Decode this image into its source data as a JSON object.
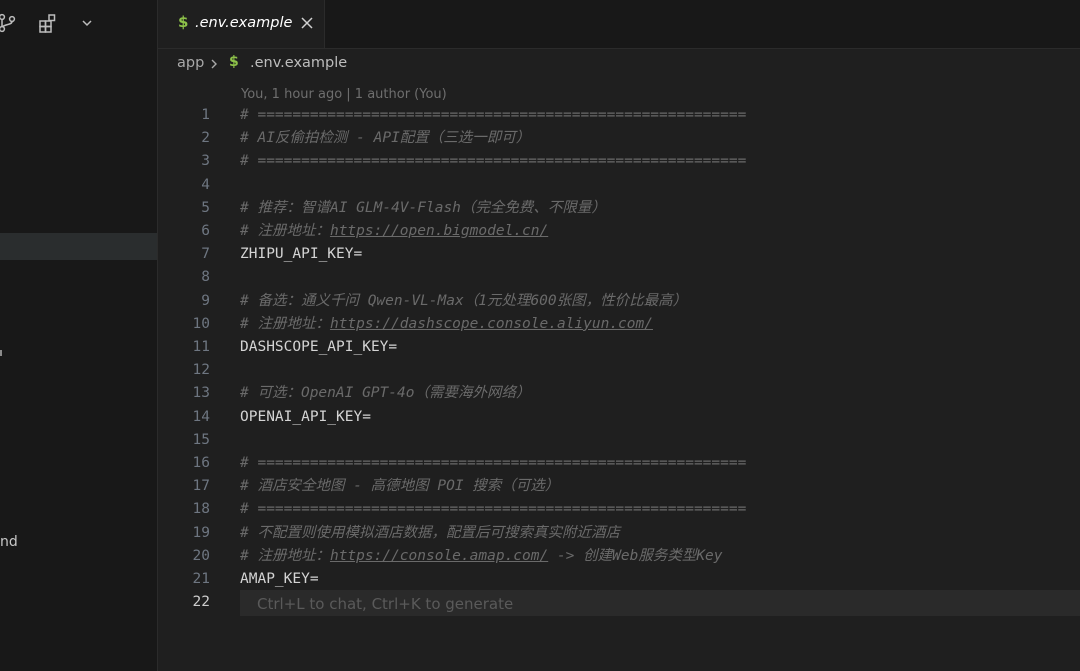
{
  "sidebar": {
    "fragment_text": "nd"
  },
  "tab": {
    "icon_glyph": "$",
    "label": ".env.example"
  },
  "breadcrumb": {
    "folder": "app",
    "icon_glyph": "$",
    "file": ".env.example"
  },
  "blame": "You, 1 hour ago | 1 author (You)",
  "lines": [
    {
      "n": "1",
      "text": "# ========================================================",
      "type": "comment"
    },
    {
      "n": "2",
      "text": "# AI反偷拍检测 - API配置（三选一即可）",
      "type": "comment"
    },
    {
      "n": "3",
      "text": "# ========================================================",
      "type": "comment"
    },
    {
      "n": "4",
      "text": "",
      "type": "blank"
    },
    {
      "n": "5",
      "text": "# 推荐：智谱AI GLM-4V-Flash（完全免费、不限量）",
      "type": "comment"
    },
    {
      "n": "6",
      "text": "# 注册地址：",
      "link": "https://open.bigmodel.cn/",
      "after": "",
      "type": "comment"
    },
    {
      "n": "7",
      "text": "ZHIPU_API_KEY=",
      "type": "key"
    },
    {
      "n": "8",
      "text": "",
      "type": "blank"
    },
    {
      "n": "9",
      "text": "# 备选：通义千问 Qwen-VL-Max（1元处理600张图，性价比最高）",
      "type": "comment"
    },
    {
      "n": "10",
      "text": "# 注册地址：",
      "link": "https://dashscope.console.aliyun.com/",
      "after": "",
      "type": "comment"
    },
    {
      "n": "11",
      "text": "DASHSCOPE_API_KEY=",
      "type": "key"
    },
    {
      "n": "12",
      "text": "",
      "type": "blank"
    },
    {
      "n": "13",
      "text": "# 可选：OpenAI GPT-4o（需要海外网络）",
      "type": "comment"
    },
    {
      "n": "14",
      "text": "OPENAI_API_KEY=",
      "type": "key"
    },
    {
      "n": "15",
      "text": "",
      "type": "blank"
    },
    {
      "n": "16",
      "text": "# ========================================================",
      "type": "comment"
    },
    {
      "n": "17",
      "text": "# 酒店安全地图 - 高德地图 POI 搜索（可选）",
      "type": "comment"
    },
    {
      "n": "18",
      "text": "# ========================================================",
      "type": "comment"
    },
    {
      "n": "19",
      "text": "# 不配置则使用模拟酒店数据，配置后可搜索真实附近酒店",
      "type": "comment"
    },
    {
      "n": "20",
      "text": "# 注册地址：",
      "link": "https://console.amap.com/",
      "after": " -> 创建Web服务类型Key",
      "type": "comment"
    },
    {
      "n": "21",
      "text": "AMAP_KEY=",
      "type": "key"
    },
    {
      "n": "22",
      "text": "",
      "type": "current",
      "hint": "Ctrl+L to chat, Ctrl+K to generate"
    }
  ],
  "colors": {
    "background": "#1f1f1f",
    "comment": "#6a6a6a",
    "dollar_icon": "#8dc149",
    "line_number": "#6e7681"
  },
  "icons": {
    "source_control": "source-control-icon",
    "extensions": "extensions-icon",
    "chevron": "chevron-down-icon",
    "close": "close-icon",
    "breadcrumb_chevron": "chevron-right-icon"
  }
}
